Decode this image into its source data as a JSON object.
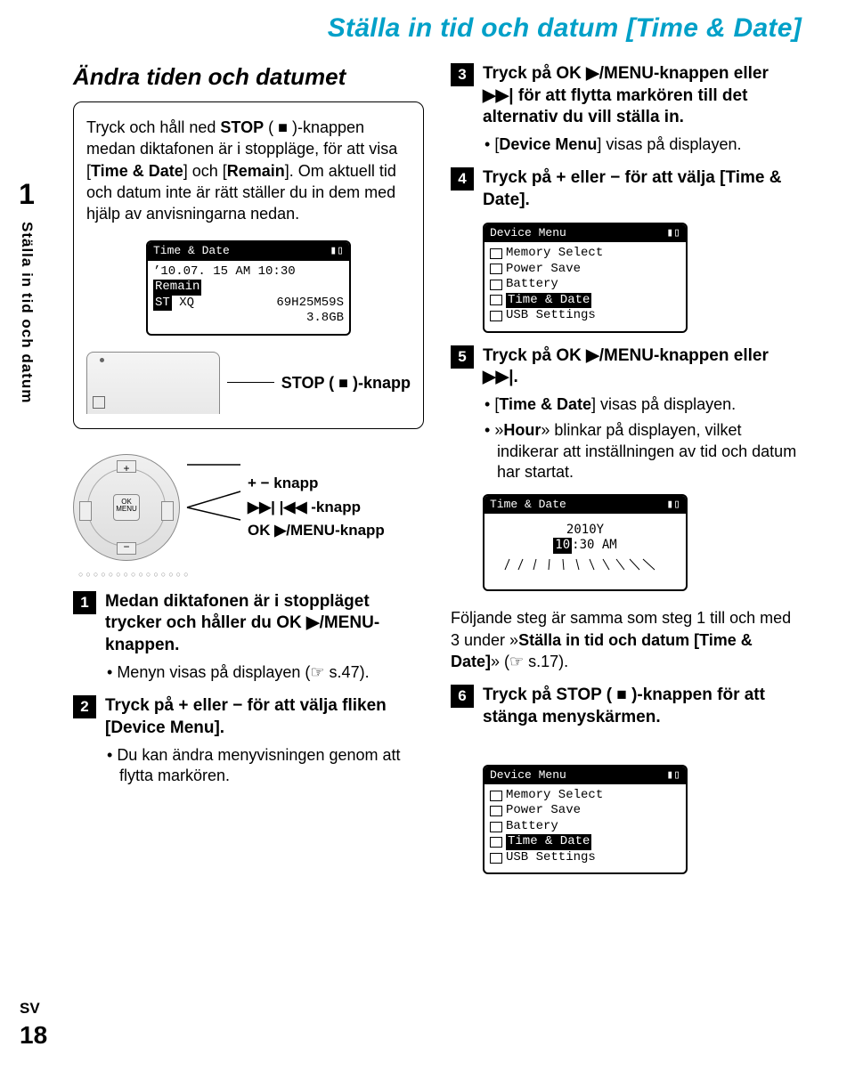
{
  "page_title": "Ställa in tid och datum [Time & Date]",
  "left_rail": {
    "chapter": "1",
    "vertical": "Ställa in tid och datum"
  },
  "subheading": "Ändra tiden och datumet",
  "intro": {
    "p1a": "Tryck och håll ned ",
    "p1b": "STOP",
    "p1c": " ( ■ )-knappen medan diktafonen är i stoppläge, för att visa [",
    "p1d": "Time & Date",
    "p1e": "] och [",
    "p1f": "Remain",
    "p1g": "]. Om aktuell tid och datum inte är rätt ställer du in dem med hjälp av anvisningarna nedan."
  },
  "lcd1": {
    "top_left": "Time & Date",
    "line1": "’10.07. 15 AM 10:30",
    "line2": "Remain",
    "line3a": "ST XQ",
    "line3b": "69H25M59S",
    "line4": "3.8GB"
  },
  "stop_label": "STOP ( ■ )-knapp",
  "dpad_labels": {
    "a": "+ − knapp",
    "b": "▶▶| |◀◀ -knapp",
    "c": "OK ▶/MENU-knapp"
  },
  "dpad_center": "OK MENU",
  "left_steps": {
    "s1": {
      "title_a": "Medan diktafonen är i stoppläget trycker och håller du ",
      "title_b": "OK ▶/MENU",
      "title_c": "-knappen.",
      "sub_a": "Menyn visas på displayen (☞ s.47)."
    },
    "s2": {
      "title_a": "Tryck på + eller − för att välja fliken [",
      "title_b": "Device Menu",
      "title_c": "].",
      "sub_a": "Du kan ändra menyvisningen genom att flytta markören."
    }
  },
  "right_steps": {
    "s3": {
      "title_a": "Tryck på ",
      "title_b": "OK ▶/MENU",
      "title_c": "-knappen eller ▶▶| för att flytta markören till det alternativ du vill ställa in.",
      "sub_a": "[",
      "sub_b": "Device Menu",
      "sub_c": "] visas på displayen."
    },
    "s4": {
      "title_a": "Tryck på + eller − för att välja [",
      "title_b": "Time & Date",
      "title_c": "]."
    },
    "s5": {
      "title_a": "Tryck på ",
      "title_b": "OK ▶/MENU",
      "title_c": "-knappen eller ▶▶|.",
      "sub1_a": "[",
      "sub1_b": "Time & Date",
      "sub1_c": "] visas på displayen.",
      "sub2_a": "»",
      "sub2_b": "Hour",
      "sub2_c": "» blinkar på displayen, vilket indikerar att inställningen av tid och datum har startat."
    },
    "s6": {
      "title_a": "Tryck på ",
      "title_b": "STOP",
      "title_c": " ( ■ )-knappen för att stänga menyskärmen."
    }
  },
  "note": {
    "a": "Följande steg är samma som steg 1 till och med 3 under »",
    "b": "Ställa in tid och datum [Time & Date]",
    "c": "» (☞ s.17)."
  },
  "lcd2": {
    "top_left": "Device Menu",
    "items": [
      "Memory Select",
      "Power Save",
      "Battery",
      "Time & Date",
      "USB Settings"
    ]
  },
  "lcd3": {
    "top_left": "Time & Date",
    "line1": "      2010Y",
    "line2": "10:30 AM"
  },
  "lcd4": {
    "top_left": "Device Menu",
    "items": [
      "Memory Select",
      "Power Save",
      "Battery",
      "Time & Date",
      "USB Settings"
    ]
  },
  "footer": {
    "lang": "SV",
    "page": "18"
  }
}
